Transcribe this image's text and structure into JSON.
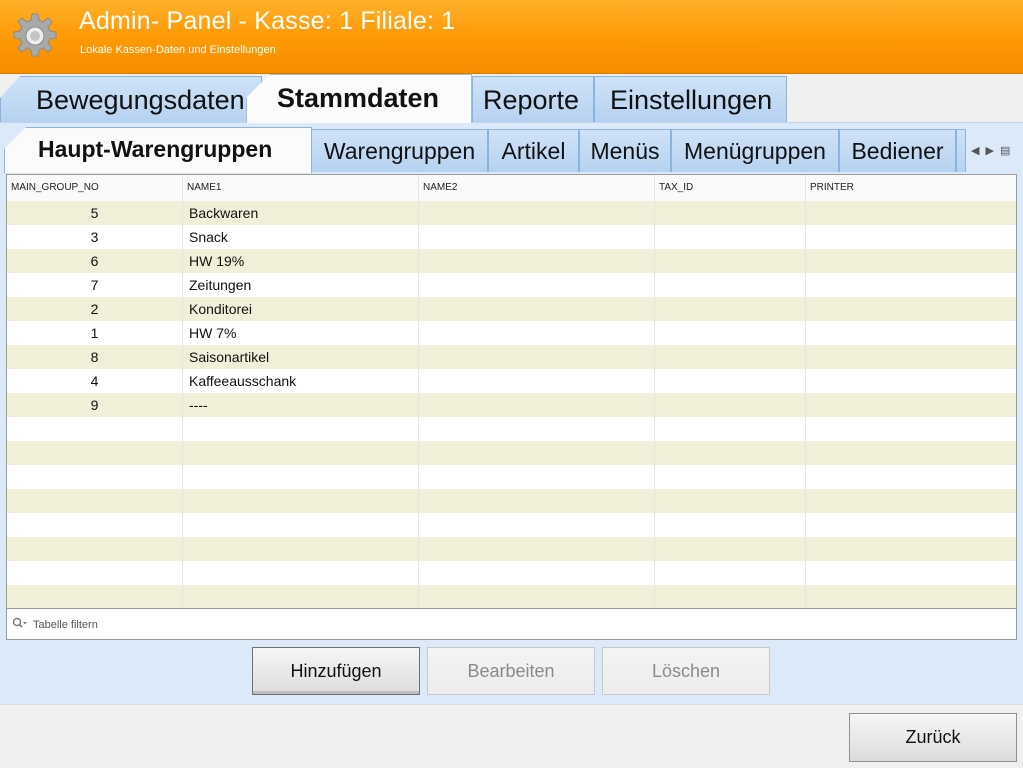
{
  "header": {
    "title": "Admin- Panel - Kasse: 1 Filiale: 1",
    "subtitle": "Lokale Kassen-Daten und Einstellungen",
    "icon": "gear-icon",
    "bg_color": "#ff9c0a"
  },
  "main_tabs": [
    {
      "label": "Bewegungsdaten",
      "active": false
    },
    {
      "label": "Stammdaten",
      "active": true
    },
    {
      "label": "Reporte",
      "active": false
    },
    {
      "label": "Einstellungen",
      "active": false
    }
  ],
  "sub_tabs": [
    {
      "label": "Haupt-Warengruppen",
      "active": true
    },
    {
      "label": "Warengruppen",
      "active": false
    },
    {
      "label": "Artikel",
      "active": false
    },
    {
      "label": "Menüs",
      "active": false
    },
    {
      "label": "Menügruppen",
      "active": false
    },
    {
      "label": "Bediener",
      "active": false
    }
  ],
  "table": {
    "columns": [
      "MAIN_GROUP_NO",
      "NAME1",
      "NAME2",
      "TAX_ID",
      "PRINTER"
    ],
    "rows": [
      [
        "5",
        "Backwaren",
        "",
        "",
        ""
      ],
      [
        "3",
        "Snack",
        "",
        "",
        ""
      ],
      [
        "6",
        "HW 19%",
        "",
        "",
        ""
      ],
      [
        "7",
        "Zeitungen",
        "",
        "",
        ""
      ],
      [
        "2",
        "Konditorei",
        "",
        "",
        ""
      ],
      [
        "1",
        "HW 7%",
        "",
        "",
        ""
      ],
      [
        "8",
        "Saisonartikel",
        "",
        "",
        ""
      ],
      [
        "4",
        "Kaffeeausschank",
        "",
        "",
        ""
      ],
      [
        "9",
        "----",
        "",
        "",
        ""
      ]
    ],
    "row_color_alt": "#f0f0d8"
  },
  "filter": {
    "placeholder": "Tabelle filtern",
    "value": ""
  },
  "actions": {
    "add_label": "Hinzufügen",
    "edit_label": "Bearbeiten",
    "delete_label": "Löschen"
  },
  "footer": {
    "back_label": "Zurück"
  }
}
